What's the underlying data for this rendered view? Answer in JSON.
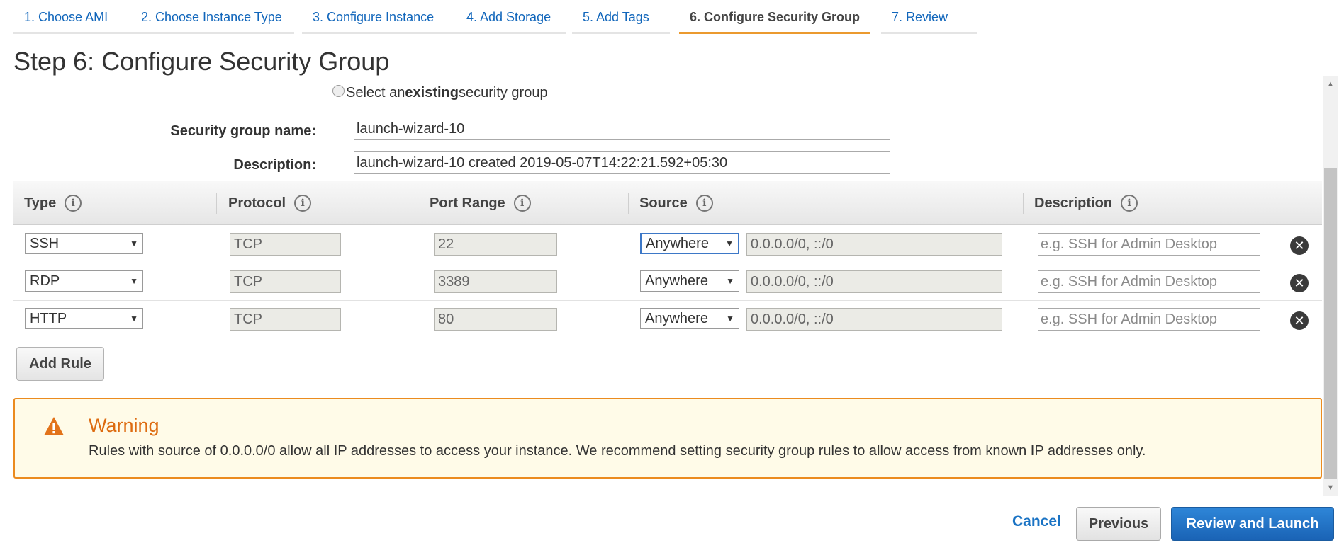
{
  "tabs": [
    {
      "label": "1. Choose AMI"
    },
    {
      "label": "2. Choose Instance Type"
    },
    {
      "label": "3. Configure Instance"
    },
    {
      "label": "4. Add Storage"
    },
    {
      "label": "5. Add Tags"
    },
    {
      "label": "6. Configure Security Group",
      "active": true
    },
    {
      "label": "7. Review"
    }
  ],
  "page_title": "Step 6: Configure Security Group",
  "existing_option": {
    "prefix": "Select an ",
    "emphasis": "existing",
    "suffix": " security group"
  },
  "form": {
    "name_label": "Security group name:",
    "name_value": "launch-wizard-10",
    "description_label": "Description:",
    "description_value": "launch-wizard-10 created 2019-05-07T14:22:21.592+05:30"
  },
  "table": {
    "headers": {
      "type": "Type",
      "protocol": "Protocol",
      "port_range": "Port Range",
      "source": "Source",
      "description": "Description"
    },
    "info_glyph": "i",
    "rows": [
      {
        "type": "SSH",
        "protocol": "TCP",
        "port": "22",
        "source_option": "Anywhere",
        "cidr": "0.0.0.0/0, ::/0",
        "desc_placeholder": "e.g. SSH for Admin Desktop"
      },
      {
        "type": "RDP",
        "protocol": "TCP",
        "port": "3389",
        "source_option": "Anywhere",
        "cidr": "0.0.0.0/0, ::/0",
        "desc_placeholder": "e.g. SSH for Admin Desktop"
      },
      {
        "type": "HTTP",
        "protocol": "TCP",
        "port": "80",
        "source_option": "Anywhere",
        "cidr": "0.0.0.0/0, ::/0",
        "desc_placeholder": "e.g. SSH for Admin Desktop"
      }
    ]
  },
  "add_rule_label": "Add Rule",
  "warning": {
    "title": "Warning",
    "text": "Rules with source of 0.0.0.0/0 allow all IP addresses to access your instance. We recommend setting security group rules to allow access from known IP addresses only."
  },
  "footer": {
    "cancel": "Cancel",
    "previous": "Previous",
    "review_launch": "Review and Launch"
  },
  "glyphs": {
    "caret": "▼",
    "remove": "✕",
    "scroll_up": "▲",
    "scroll_down": "▼"
  },
  "colors": {
    "link": "#1166bb",
    "active_tab_underline": "#eb9a2f",
    "warning_border": "#eb8b1f",
    "warning_title": "#dd6b10",
    "primary_button": "#1a63b5"
  },
  "icons": {
    "info": "info-icon",
    "remove": "remove-rule-icon",
    "warning": "warning-icon"
  }
}
